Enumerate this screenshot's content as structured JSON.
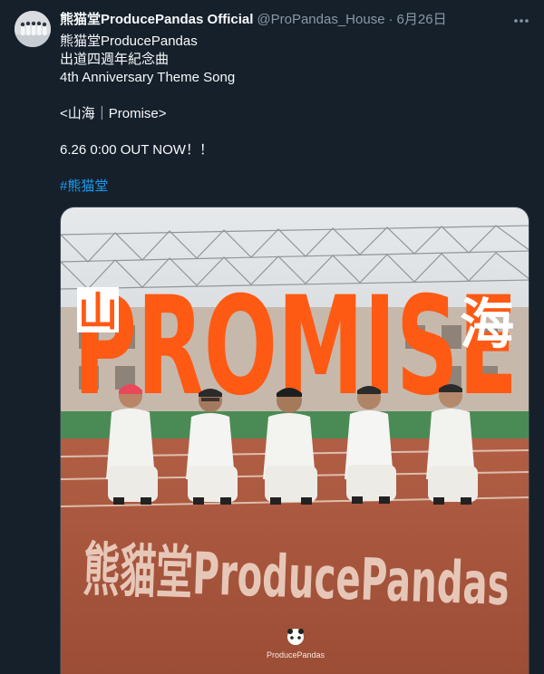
{
  "tweet": {
    "display_name": "熊猫堂ProducePandas Official",
    "handle": "@ProPandas_House",
    "separator": "·",
    "date": "6月26日",
    "more_icon": "more-horizontal-icon",
    "lines": [
      "熊猫堂ProducePandas",
      "出道四週年紀念曲",
      "4th Anniversary Theme Song",
      "",
      "<山海｜Promise>",
      "",
      "6.26  0:00  OUT NOW！！",
      ""
    ],
    "hashtag": "#熊猫堂"
  },
  "media": {
    "title_text": "PROMISE",
    "glyph_left": "山",
    "glyph_right": "海",
    "track_text": "熊貓堂ProducePandas",
    "logo_text": "ProducePandas",
    "colors": {
      "title_orange": "#ff5a14",
      "track": "#a5533b",
      "sky": "#dfe3e6",
      "grass": "#3f7d4a"
    }
  }
}
